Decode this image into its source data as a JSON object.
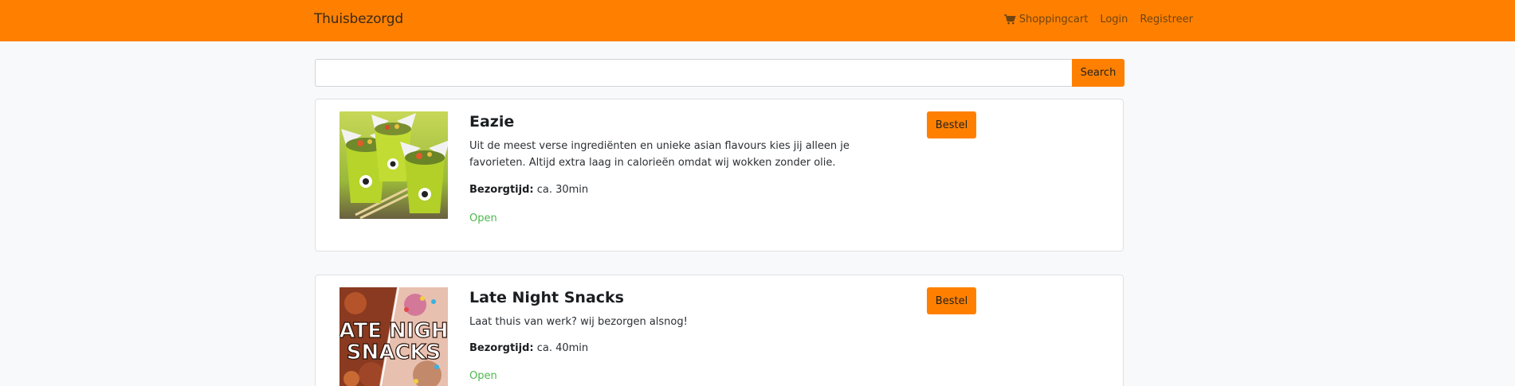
{
  "navbar": {
    "brand": "Thuisbezorgd",
    "links": {
      "cart": "Shoppingcart",
      "login": "Login",
      "register": "Registreer"
    },
    "cart_icon": "shopping-cart-icon",
    "color": "#ff8000"
  },
  "search": {
    "value": "",
    "placeholder": "",
    "button_label": "Search"
  },
  "restaurants": [
    {
      "name": "Eazie",
      "description": "Uit de meest verse ingrediënten en unieke asian flavours kies jij alleen je favorieten. Altijd extra laag in calorieën omdat wij wokken zonder olie.",
      "delivery_label": "Bezorgtijd:",
      "delivery_time": "ca. 30min",
      "status": "Open",
      "order_label": "Bestel"
    },
    {
      "name": "Late Night Snacks",
      "description": "Laat thuis van werk? wij bezorgen alsnog!",
      "delivery_label": "Bezorgtijd:",
      "delivery_time": "ca. 40min",
      "status": "Open",
      "order_label": "Bestel",
      "image_text": "ATE NIGHT SNACKS"
    }
  ],
  "colors": {
    "accent": "#ff8000",
    "status_open": "#4cb84c",
    "background": "#f8f9fa"
  }
}
